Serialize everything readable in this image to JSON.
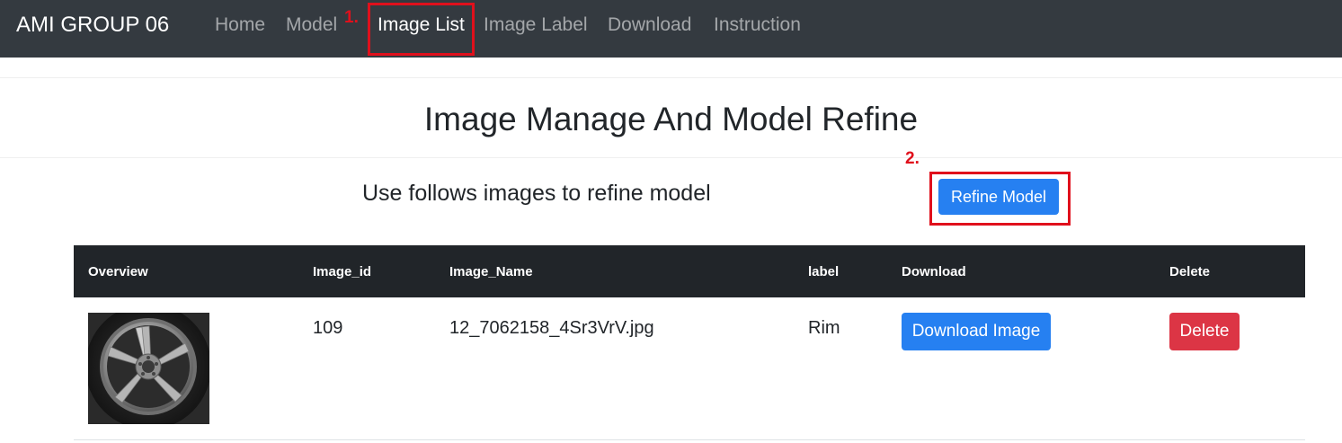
{
  "navbar": {
    "brand": "AMI GROUP 06",
    "links": [
      {
        "label": "Home"
      },
      {
        "label": "Model"
      },
      {
        "label": "Image List"
      },
      {
        "label": "Image Label"
      },
      {
        "label": "Download"
      },
      {
        "label": "Instruction"
      }
    ]
  },
  "annotations": {
    "step1": "1.",
    "step2": "2.",
    "highlight_color": "#e0101c"
  },
  "header": {
    "title": "Image Manage And Model Refine",
    "subtitle": "Use follows images to refine model",
    "refine_button": "Refine Model"
  },
  "table": {
    "columns": [
      "Overview",
      "Image_id",
      "Image_Name",
      "label",
      "Download",
      "Delete"
    ],
    "rows": [
      {
        "thumbnail_icon": "car-rim-thumbnail",
        "image_id": "109",
        "image_name": "12_7062158_4Sr3VrV.jpg",
        "label": "Rim",
        "download_button": "Download Image",
        "delete_button": "Delete"
      }
    ]
  },
  "colors": {
    "navbar_bg": "#343a40",
    "table_head_bg": "#212529",
    "primary": "#2680f1",
    "danger": "#dc3545"
  }
}
